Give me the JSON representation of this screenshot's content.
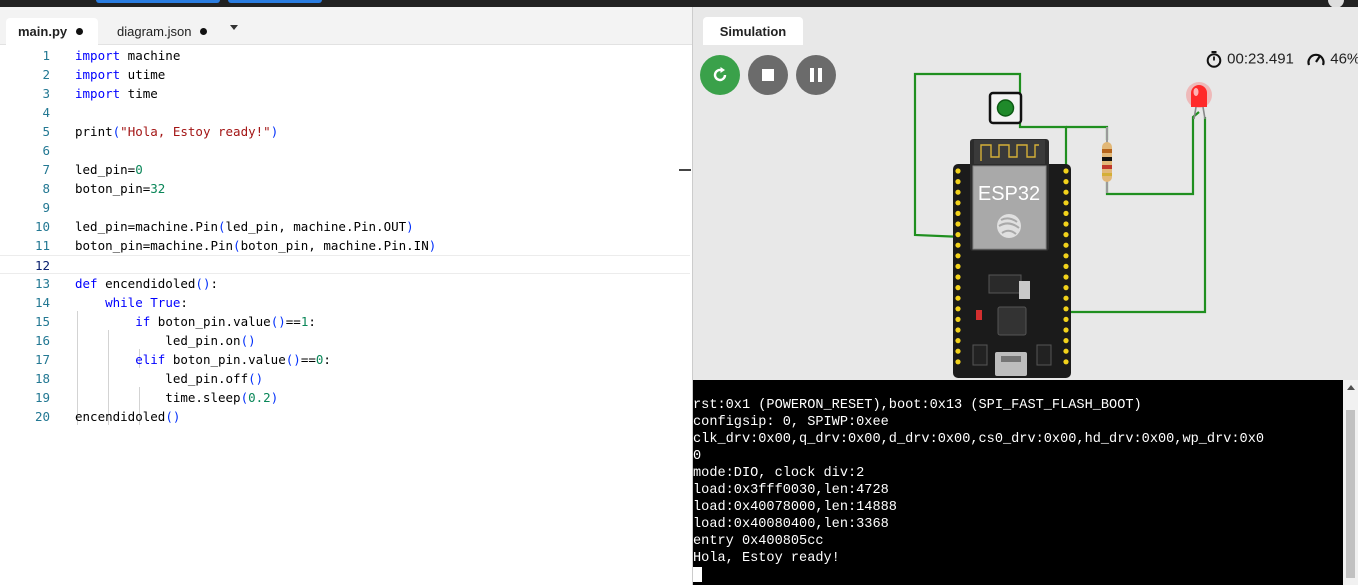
{
  "editor": {
    "tabs": [
      {
        "label": "main.py",
        "active": true,
        "unsaved": true
      },
      {
        "label": "diagram.json",
        "active": false,
        "unsaved": true
      }
    ],
    "line_numbers": [
      "1",
      "2",
      "3",
      "4",
      "5",
      "6",
      "7",
      "8",
      "9",
      "10",
      "11",
      "12",
      "13",
      "14",
      "15",
      "16",
      "17",
      "18",
      "19",
      "20"
    ],
    "current_line": 12,
    "lines": [
      [
        {
          "t": "import",
          "c": "kw"
        },
        {
          "t": " machine",
          "c": ""
        }
      ],
      [
        {
          "t": "import",
          "c": "kw"
        },
        {
          "t": " utime",
          "c": ""
        }
      ],
      [
        {
          "t": "import",
          "c": "kw"
        },
        {
          "t": " time",
          "c": ""
        }
      ],
      [],
      [
        {
          "t": "print",
          "c": ""
        },
        {
          "t": "(",
          "c": "br1"
        },
        {
          "t": "\"Hola, Estoy ready!\"",
          "c": "str"
        },
        {
          "t": ")",
          "c": "br1"
        }
      ],
      [],
      [
        {
          "t": "led_pin=",
          "c": ""
        },
        {
          "t": "0",
          "c": "num"
        }
      ],
      [
        {
          "t": "boton_pin=",
          "c": ""
        },
        {
          "t": "32",
          "c": "num"
        }
      ],
      [],
      [
        {
          "t": "led_pin=machine.Pin",
          "c": ""
        },
        {
          "t": "(",
          "c": "br1"
        },
        {
          "t": "led_pin, machine.Pin.OUT",
          "c": ""
        },
        {
          "t": ")",
          "c": "br1"
        }
      ],
      [
        {
          "t": "boton_pin=machine.Pin",
          "c": ""
        },
        {
          "t": "(",
          "c": "br1"
        },
        {
          "t": "boton_pin, machine.Pin.IN",
          "c": ""
        },
        {
          "t": ")",
          "c": "br1"
        }
      ],
      [],
      [
        {
          "t": "def",
          "c": "kw"
        },
        {
          "t": " encendidoled",
          "c": ""
        },
        {
          "t": "()",
          "c": "br1"
        },
        {
          "t": ":",
          "c": ""
        }
      ],
      [
        {
          "t": "    ",
          "c": ""
        },
        {
          "t": "while",
          "c": "kw"
        },
        {
          "t": " ",
          "c": ""
        },
        {
          "t": "True",
          "c": "kw"
        },
        {
          "t": ":",
          "c": ""
        }
      ],
      [
        {
          "t": "        ",
          "c": ""
        },
        {
          "t": "if",
          "c": "kw"
        },
        {
          "t": " boton_pin.value",
          "c": ""
        },
        {
          "t": "()",
          "c": "br1"
        },
        {
          "t": "==",
          "c": ""
        },
        {
          "t": "1",
          "c": "num"
        },
        {
          "t": ":",
          "c": ""
        }
      ],
      [
        {
          "t": "            led_pin.on",
          "c": ""
        },
        {
          "t": "()",
          "c": "br1"
        }
      ],
      [
        {
          "t": "        ",
          "c": ""
        },
        {
          "t": "elif",
          "c": "kw"
        },
        {
          "t": " boton_pin.value",
          "c": ""
        },
        {
          "t": "()",
          "c": "br1"
        },
        {
          "t": "==",
          "c": ""
        },
        {
          "t": "0",
          "c": "num"
        },
        {
          "t": ":",
          "c": ""
        }
      ],
      [
        {
          "t": "            led_pin.off",
          "c": ""
        },
        {
          "t": "()",
          "c": "br1"
        }
      ],
      [
        {
          "t": "            time.sleep",
          "c": ""
        },
        {
          "t": "(",
          "c": "br1"
        },
        {
          "t": "0.2",
          "c": "num"
        },
        {
          "t": ")",
          "c": "br1"
        }
      ],
      [
        {
          "t": "encendidoled",
          "c": ""
        },
        {
          "t": "()",
          "c": "br1"
        }
      ]
    ]
  },
  "simulation": {
    "tab_label": "Simulation",
    "elapsed": "00:23.491",
    "performance": "46%",
    "controls": [
      "restart-icon",
      "stop-icon",
      "pause-icon"
    ],
    "board_label": "ESP32",
    "led_state": "on",
    "colors": {
      "wire": "#1f8f1f",
      "led": "#ff2a2a",
      "start": "#3aa14a",
      "control": "#6b6b6b"
    }
  },
  "serial": {
    "lines": [
      "rst:0x1 (POWERON_RESET),boot:0x13 (SPI_FAST_FLASH_BOOT)",
      "configsip: 0, SPIWP:0xee",
      "clk_drv:0x00,q_drv:0x00,d_drv:0x00,cs0_drv:0x00,hd_drv:0x00,wp_drv:0x0",
      "0",
      "mode:DIO, clock div:2",
      "load:0x3fff0030,len:4728",
      "load:0x40078000,len:14888",
      "load:0x40080400,len:3368",
      "entry 0x400805cc",
      "Hola, Estoy ready!"
    ]
  }
}
